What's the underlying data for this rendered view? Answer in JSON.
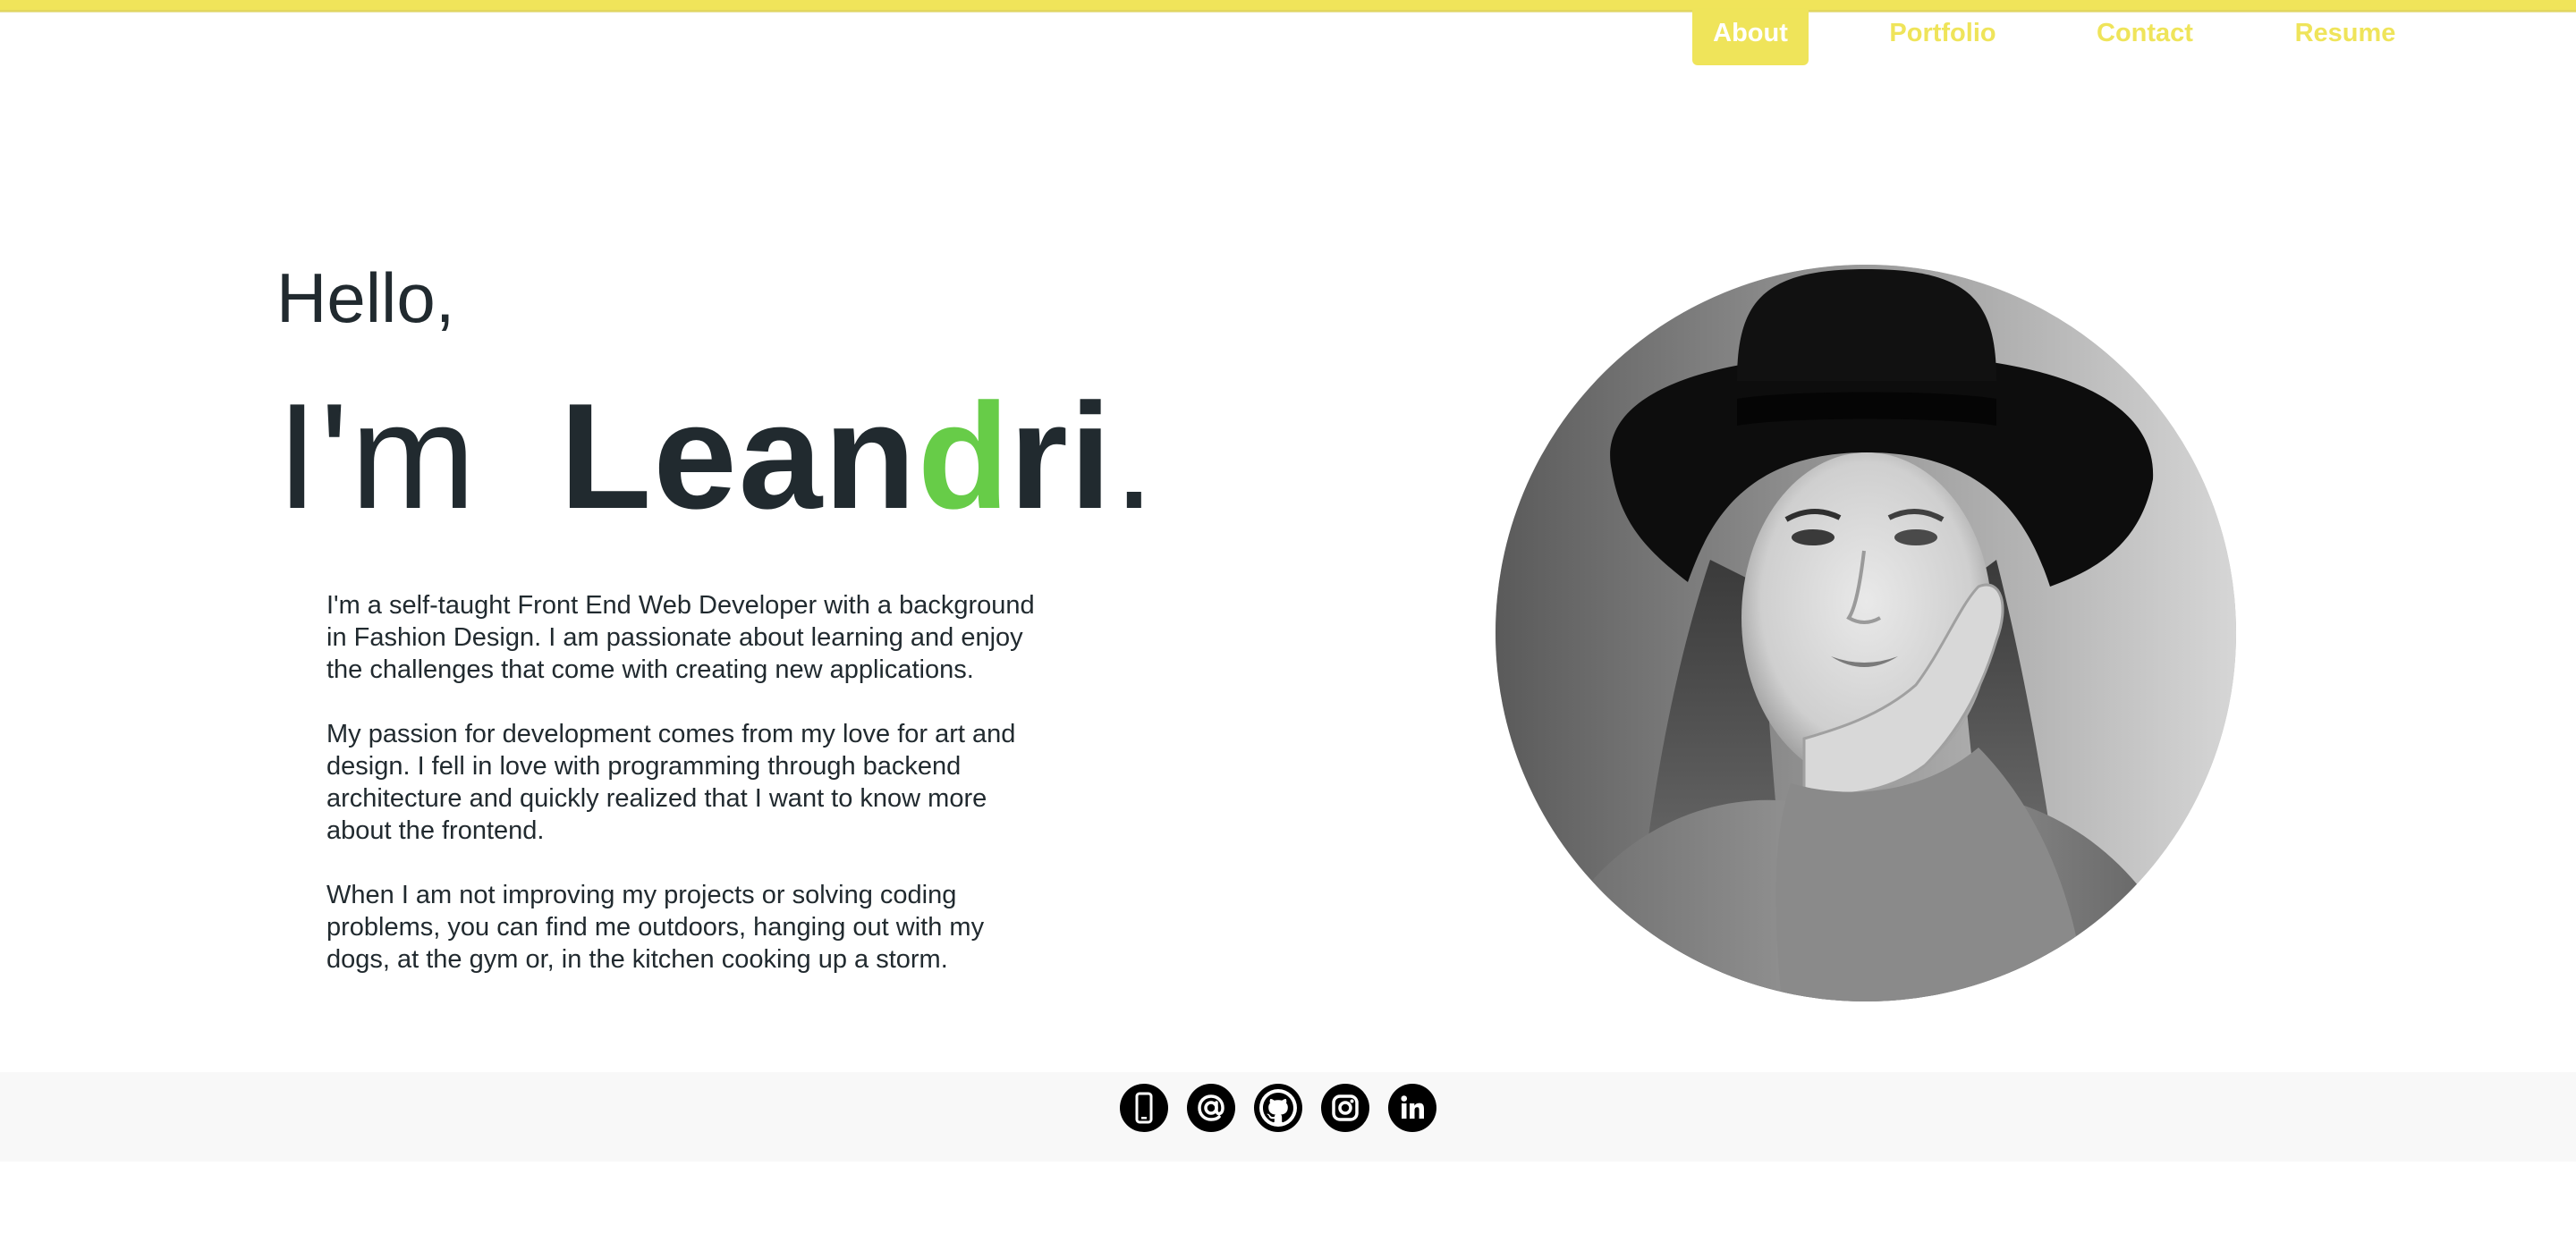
{
  "nav": {
    "items": [
      {
        "label": "About",
        "active": true
      },
      {
        "label": "Portfolio",
        "active": false
      },
      {
        "label": "Contact",
        "active": false
      },
      {
        "label": "Resume",
        "active": false
      }
    ]
  },
  "hero": {
    "greeting": "Hello,",
    "im": "I'm",
    "name_part1": "Lean",
    "name_accent": "d",
    "name_part2": "ri",
    "period": "."
  },
  "bio": {
    "paragraphs": [
      "I'm a self-taught Front End Web Developer with a background in Fashion Design. I am passionate about learning and enjoy the challenges that come with creating new applications.",
      "My passion for development comes from my love for art and design. I fell in love with programming through backend architecture and quickly realized that I want to know more about the frontend.",
      "When I am not improving my projects or solving coding problems, you can find me outdoors, hanging out with my dogs, at the gym or, in the kitchen cooking up a storm."
    ]
  },
  "social": {
    "icons": [
      "phone-icon",
      "email-at-icon",
      "github-icon",
      "instagram-icon",
      "linkedin-icon"
    ]
  },
  "colors": {
    "accent_yellow": "#efe45a",
    "accent_green": "#67cc48",
    "text_dark": "#212a2f",
    "footer_bg": "#f8f8f8"
  }
}
